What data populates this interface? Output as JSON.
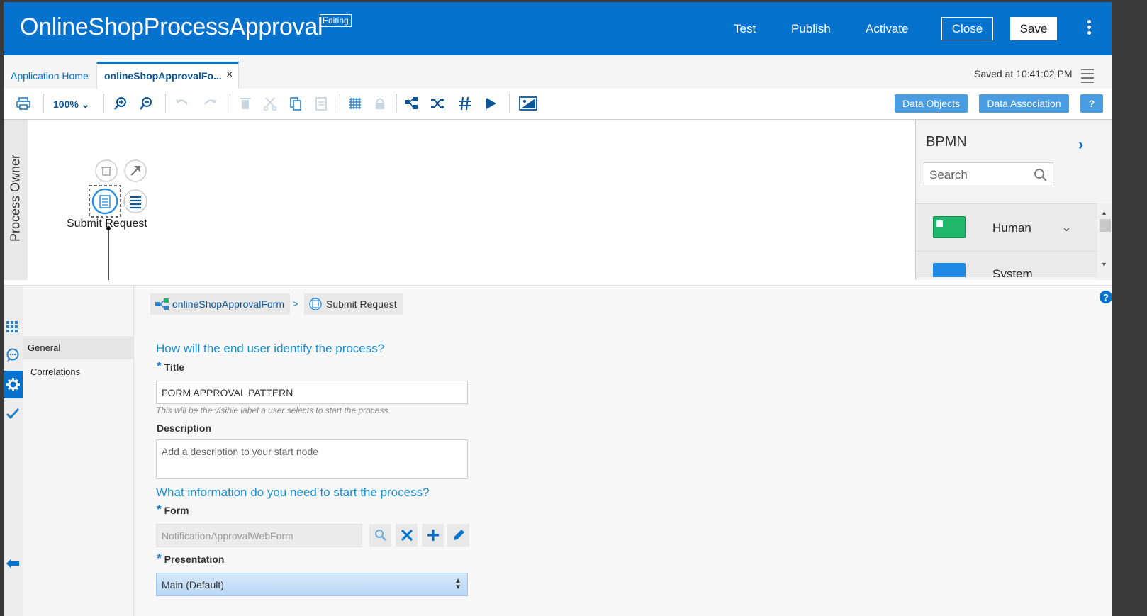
{
  "header": {
    "title": "OnlineShopProcessApproval",
    "badge": "Editing",
    "test": "Test",
    "publish": "Publish",
    "activate": "Activate",
    "close": "Close",
    "save": "Save"
  },
  "tabs": {
    "home": "Application Home",
    "active": "onlineShopApprovalFo...",
    "close_glyph": "×",
    "saved_at": "Saved at 10:41:02 PM"
  },
  "toolbar": {
    "zoom": "100%",
    "data_objects": "Data Objects",
    "data_association": "Data Association",
    "help": "?"
  },
  "canvas": {
    "lane": "Process Owner",
    "node_label": "Submit Request"
  },
  "palette": {
    "title": "BPMN",
    "search_placeholder": "Search",
    "items": [
      "Human",
      "System"
    ]
  },
  "nav": {
    "items": [
      "General",
      "Correlations"
    ]
  },
  "breadcrumb": {
    "process": "onlineShopApprovalForm",
    "separator": ">",
    "node": "Submit Request"
  },
  "form": {
    "q1": "How will the end user identify the process?",
    "title_label": "Title",
    "title_value": "FORM APPROVAL PATTERN",
    "title_hint": "This will be the visible label a user selects to start the process.",
    "desc_label": "Description",
    "desc_placeholder": "Add a description to your start node",
    "q2": "What information do you need to start the process?",
    "form_label": "Form",
    "form_value": "NotificationApprovalWebForm",
    "presentation_label": "Presentation",
    "presentation_value": "Main (Default)",
    "required_mark": "*"
  },
  "colors": {
    "brand": "#0572ce",
    "accent_button": "#4a9de0",
    "human_tile": "#1fb86a",
    "system_tile": "#1e88e5"
  }
}
